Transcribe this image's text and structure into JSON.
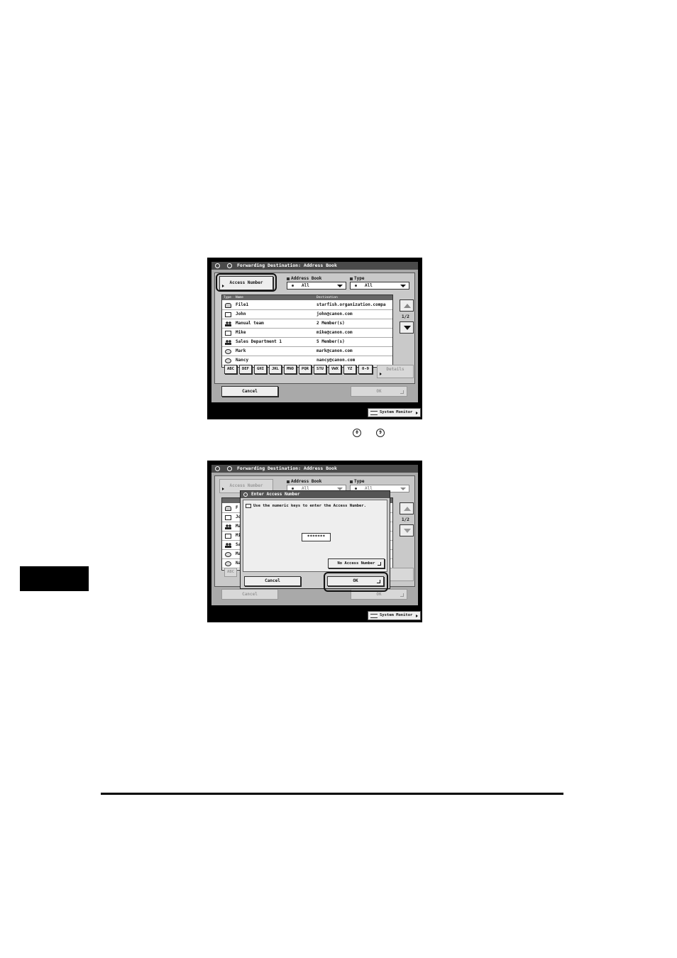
{
  "screen1": {
    "title": "Forwarding Destination: Address Book",
    "access_number_button": "Access Number",
    "address_book_label": "Address Book",
    "address_book_value": "All",
    "type_label": "Type",
    "type_value": "All",
    "list_header": {
      "type": "Type",
      "name": "Name",
      "destination": "Destination"
    },
    "rows": [
      {
        "icon": "file-icon",
        "name": "File1",
        "destination": "starfish.organization.compa"
      },
      {
        "icon": "mail-icon",
        "name": "John",
        "destination": "john@canon.com"
      },
      {
        "icon": "group-icon",
        "name": "Manual team",
        "destination": "2 Member(s)"
      },
      {
        "icon": "mail-icon",
        "name": "Mike",
        "destination": "mike@canon.com"
      },
      {
        "icon": "group-icon",
        "name": "Sales Department 1",
        "destination": "5 Member(s)"
      },
      {
        "icon": "shared-icon",
        "name": "Mark",
        "destination": "mark@canon.com"
      },
      {
        "icon": "shared-icon",
        "name": "Nancy",
        "destination": "nancy@canon.com"
      }
    ],
    "page_indicator": "1/2",
    "key_buttons": [
      "ABC",
      "DEF",
      "GHI",
      "JKL",
      "MNO",
      "PQR",
      "STU",
      "VWX",
      "YZ",
      "0-9"
    ],
    "details_button": "Details",
    "cancel_button": "Cancel",
    "ok_button": "OK",
    "system_monitor": "System Monitor"
  },
  "keys_caption": {
    "key1": "0",
    "key2": "9"
  },
  "screen2": {
    "title": "Forwarding Destination: Address Book",
    "access_number_button": "Access Number",
    "address_book_label": "Address Book",
    "address_book_value": "All",
    "type_label": "Type",
    "type_value": "All",
    "page_indicator": "1/2",
    "row_initials": [
      "F",
      "Jo",
      "Ma",
      "Mi",
      "Sa",
      "Ma",
      "Na"
    ],
    "key_button_first": "ABC",
    "cancel_button": "Cancel",
    "ok_button": "OK",
    "system_monitor": "System Monitor",
    "dialog": {
      "title": "Enter Access Number",
      "instruction": "Use the numeric keys to enter the Access Number.",
      "masked_value": "*******",
      "no_access_number_button": "No Access Number",
      "cancel_button": "Cancel",
      "ok_button": "OK"
    }
  }
}
